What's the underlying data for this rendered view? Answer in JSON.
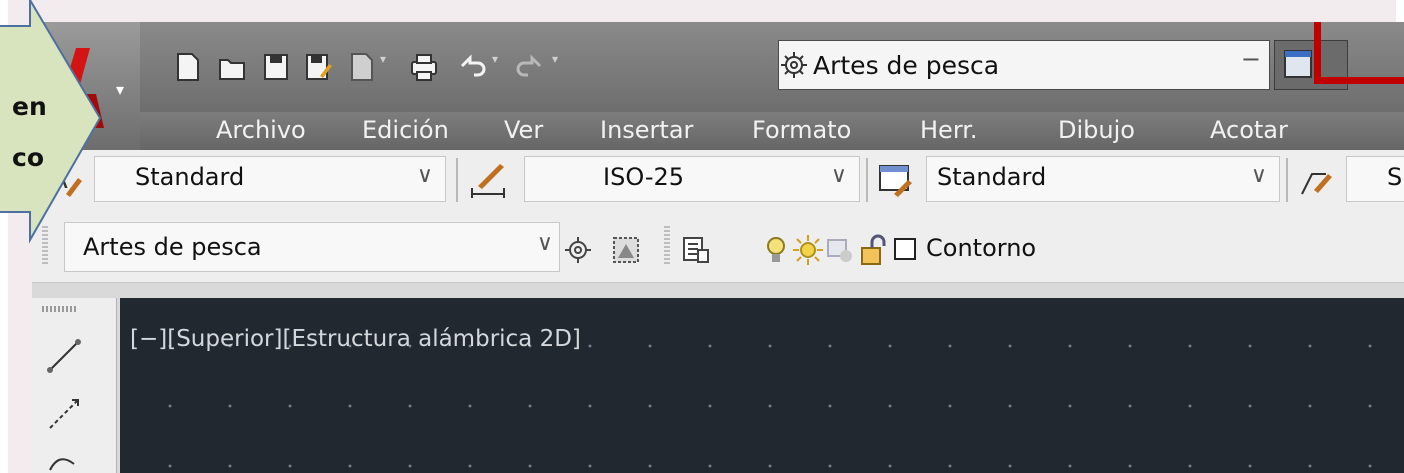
{
  "callout": {
    "line1": "en",
    "line2": "co",
    "fill_color": "#d7e4bd"
  },
  "quick_access": {
    "workspace_label": "Artes de pesca",
    "icons": [
      "new-icon",
      "open-icon",
      "save-icon",
      "saveas-icon",
      "plot-icon",
      "print-icon",
      "undo-icon",
      "redo-icon",
      "workspace-gear-icon"
    ]
  },
  "menu": {
    "items": [
      "Archivo",
      "Edición",
      "Ver",
      "Insertar",
      "Formato",
      "Herr.",
      "Dibujo",
      "Acotar"
    ]
  },
  "styles": {
    "text_style": "Standard",
    "dim_style": "ISO-25",
    "table_style": "Standard",
    "multileader_style": "S"
  },
  "layers": {
    "current_layer": "Artes de pesca",
    "layer_state_name": "Contorno"
  },
  "viewport": {
    "label": "[−][Superior][Estructura alámbrica 2D]"
  },
  "colors": {
    "annotation_arrow": "#c00000",
    "drawing_bg": "#212830",
    "menubar": "#6e6e6e"
  }
}
